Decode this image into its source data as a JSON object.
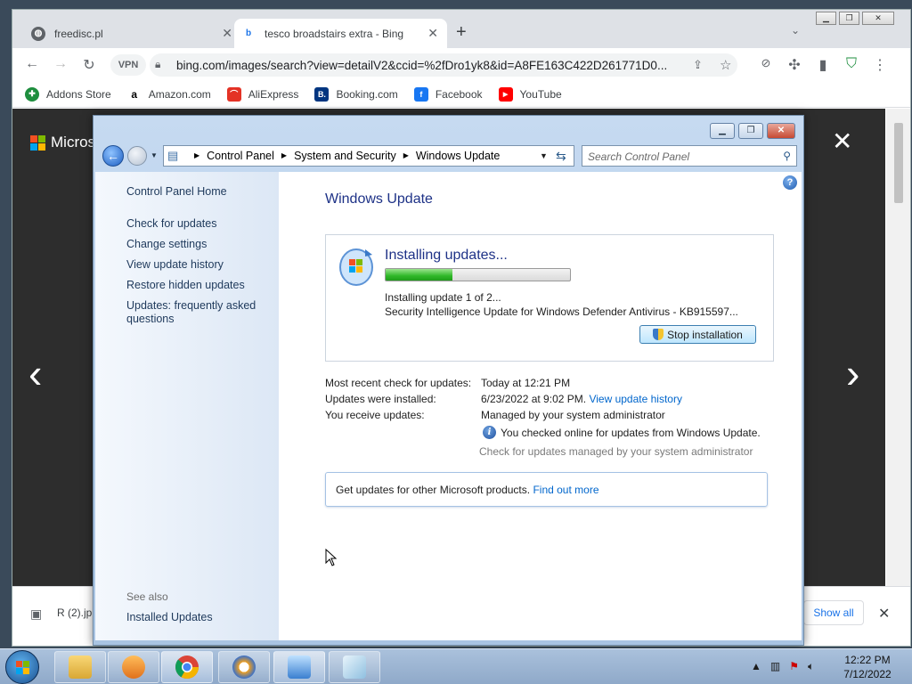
{
  "browser": {
    "tabs": [
      {
        "title": "freedisc.pl",
        "active": false
      },
      {
        "title": "tesco broadstairs extra - Bing im",
        "active": true
      }
    ],
    "url": "bing.com/images/search?view=detailV2&ccid=%2fDro1yk8&id=A8FE163C422D261771D0...",
    "vpn_label": "VPN",
    "bookmarks": [
      "Addons Store",
      "Amazon.com",
      "AliExpress",
      "Booking.com",
      "Facebook",
      "YouTube"
    ],
    "page_brand": "Microsc",
    "download_file": "R (2).jp",
    "show_all": "Show all"
  },
  "control_panel": {
    "breadcrumb": [
      "Control Panel",
      "System and Security",
      "Windows Update"
    ],
    "search_placeholder": "Search Control Panel",
    "left_links": [
      "Control Panel Home",
      "Check for updates",
      "Change settings",
      "View update history",
      "Restore hidden updates",
      "Updates: frequently asked questions"
    ],
    "see_also": "See also",
    "installed_updates": "Installed Updates",
    "title": "Windows Update",
    "installing": {
      "heading": "Installing updates...",
      "progress": 0.36,
      "line1": "Installing update 1 of 2...",
      "line2": "Security Intelligence Update for Windows Defender Antivirus - KB915597...",
      "stop_button": "Stop installation"
    },
    "info": {
      "recent_check_label": "Most recent check for updates:",
      "recent_check_value": "Today at 12:21 PM",
      "installed_label": "Updates were installed:",
      "installed_value": "6/23/2022 at 9:02 PM.",
      "installed_link": "View update history",
      "receive_label": "You receive updates:",
      "receive_value": "Managed by your system administrator",
      "online_note": "You checked online for updates from Windows Update.",
      "managed_note": "Check for updates managed by your system administrator"
    },
    "other_products": "Get updates for other Microsoft products.",
    "find_out_more": "Find out more"
  },
  "taskbar": {
    "time": "12:22 PM",
    "date": "7/12/2022"
  },
  "colors": {
    "link": "#0066cc",
    "title_blue": "#1e3287",
    "progress_green": "#2fb828"
  }
}
